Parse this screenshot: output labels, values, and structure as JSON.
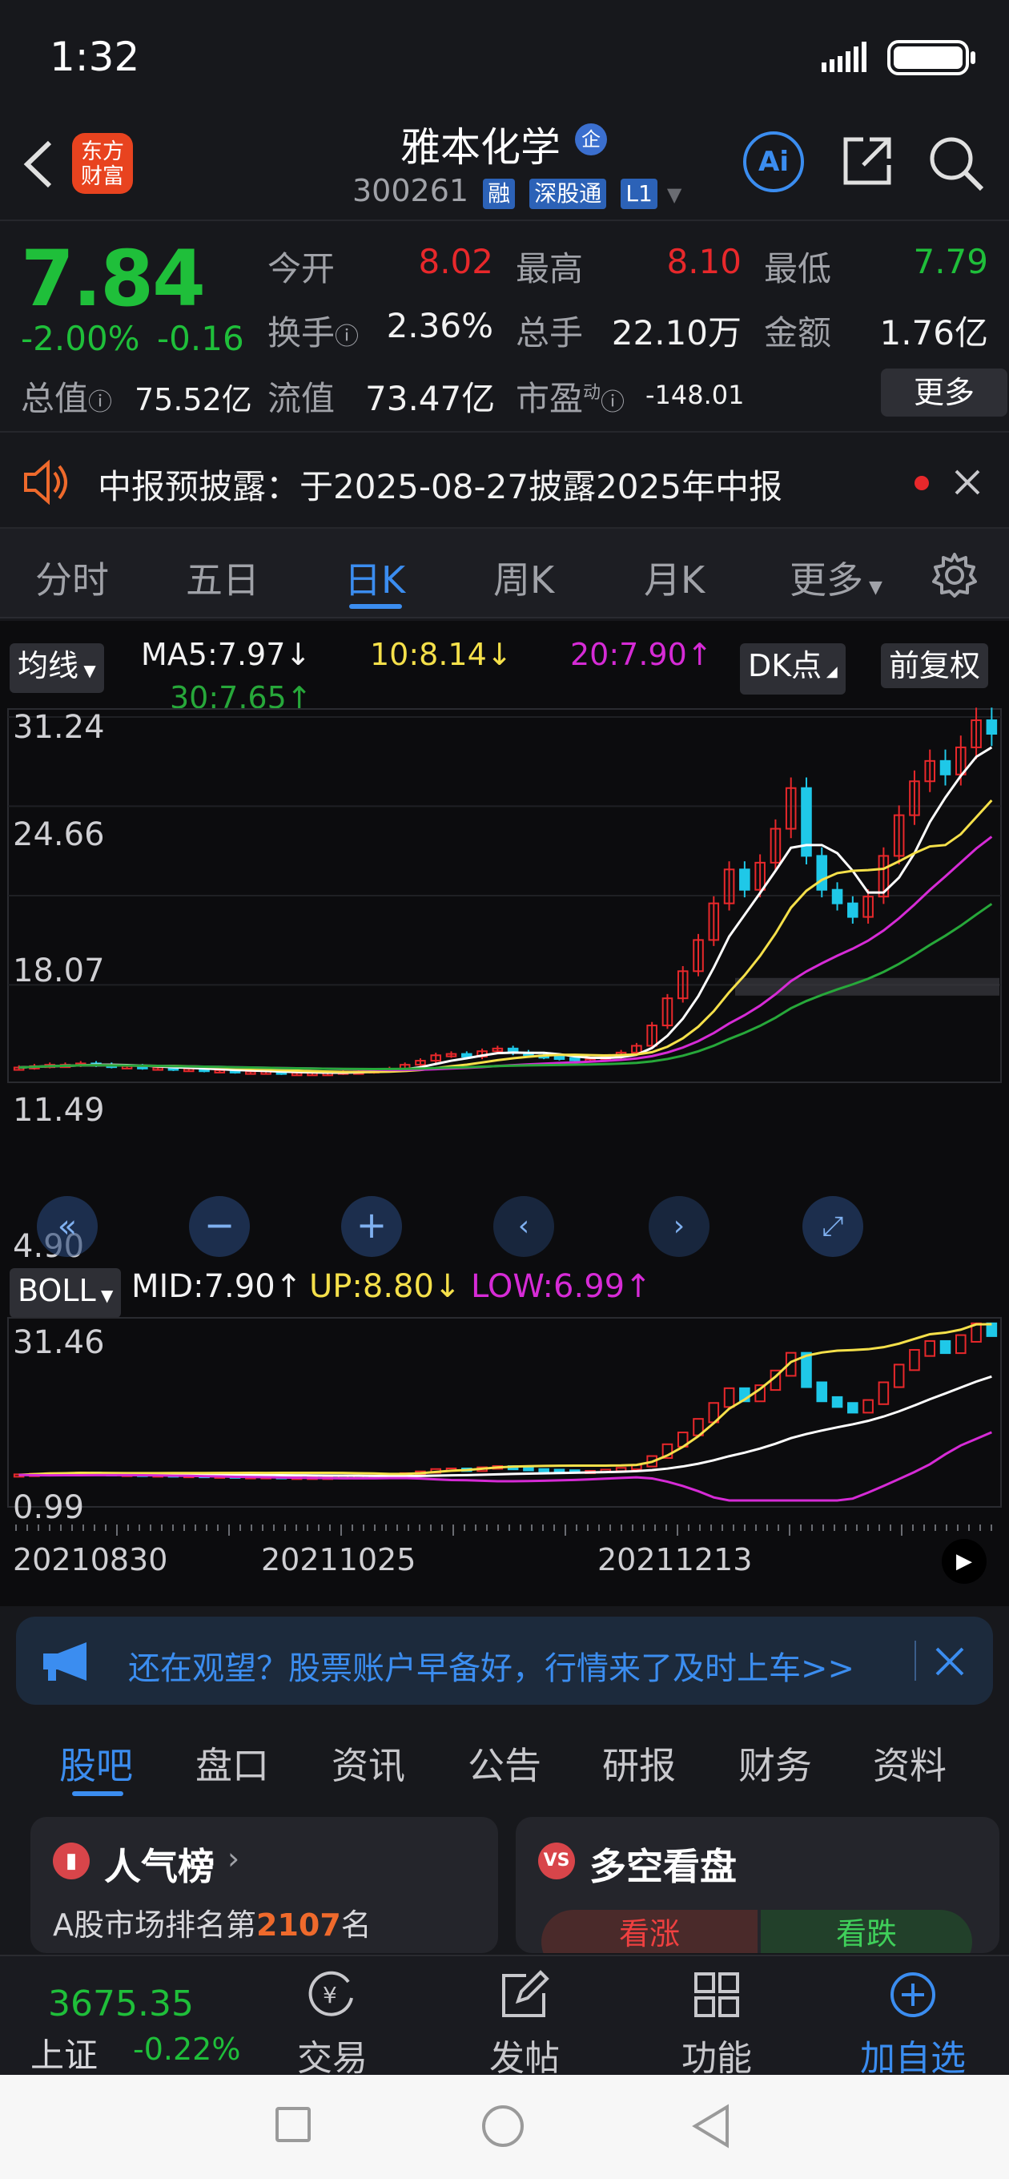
{
  "status_bar": {
    "time": "1:32"
  },
  "header": {
    "logo_text": "东方\n财富",
    "name": "雅本化学",
    "name_badge": "企",
    "code": "300261",
    "tags": [
      "融",
      "深股通",
      "L1"
    ],
    "ai_label": "Ai"
  },
  "quote": {
    "price": "7.84",
    "change_pct": "-2.00%",
    "change": "-0.16",
    "open_label": "今开",
    "open": "8.02",
    "high_label": "最高",
    "high": "8.10",
    "low_label": "最低",
    "low": "7.79",
    "turnover_label": "换手",
    "turnover": "2.36%",
    "volume_label": "总手",
    "volume": "22.10万",
    "amount_label": "金额",
    "amount": "1.76亿",
    "mktcap_label": "总值",
    "mktcap": "75.52亿",
    "float_label": "流值",
    "float": "73.47亿",
    "pe_label": "市盈",
    "pe_sup": "动",
    "pe": "-148.01",
    "more_label": "更多"
  },
  "notice": {
    "text": "中报预披露：于2025-08-27披露2025年中报"
  },
  "ktabs": [
    "分时",
    "五日",
    "日K",
    "周K",
    "月K",
    "更多"
  ],
  "ktabs_active": 2,
  "main_chart": {
    "indicator_button": "均线",
    "ma5": "MA5:7.97↓",
    "ma10": "10:8.14↓",
    "ma20": "20:7.90↑",
    "ma30": "30:7.65↑",
    "dk_button": "DK点",
    "adjust_button": "前复权",
    "y_labels": [
      "31.24",
      "24.66",
      "18.07",
      "11.49",
      "4.90"
    ]
  },
  "boll_chart": {
    "indicator_button": "BOLL",
    "mid": "MID:7.90↑",
    "up": "UP:8.80↓",
    "low": "LOW:6.99↑",
    "y_labels": [
      "31.46",
      "0.99"
    ]
  },
  "x_labels": [
    "20210830",
    "20211025",
    "20211213"
  ],
  "colors": {
    "up": "#e8282b",
    "down": "#1fc8e8",
    "ma5": "#ffffff",
    "ma10": "#f5e04a",
    "ma20": "#d62bd6",
    "ma30": "#27a83a",
    "accent": "#3b8df0"
  },
  "ad_banner": {
    "text": "还在观望？股票账户早备好，行情来了及时上车>>"
  },
  "bottom_tabs": [
    "股吧",
    "盘口",
    "资讯",
    "公告",
    "研报",
    "财务",
    "资料"
  ],
  "bottom_tabs_active": 0,
  "cards": {
    "popularity_title": "人气榜",
    "popularity_text_prefix": "A股市场排名第",
    "popularity_rank": "2107",
    "popularity_text_suffix": "名",
    "sentiment_title": "多空看盘",
    "bull_label": "看涨",
    "bear_label": "看跌"
  },
  "bottom_nav": {
    "index_value": "3675.35",
    "index_name": "上证",
    "index_change": "-0.22%",
    "trade": "交易",
    "post": "发帖",
    "functions": "功能",
    "add_watch": "加自选"
  },
  "chart_data": {
    "type": "candlestick",
    "title": "",
    "indicators": [
      "MA5",
      "MA10",
      "MA20",
      "MA30",
      "BOLL"
    ],
    "y_ticks_main": [
      31.24,
      24.66,
      18.07,
      11.49,
      4.9
    ],
    "y_ticks_boll": [
      31.46,
      0.99
    ],
    "x_ticks": [
      "20210830",
      "20211025",
      "20211213"
    ],
    "ylim": [
      4.9,
      31.24
    ],
    "close_series_approx": [
      5.4,
      5.5,
      5.6,
      5.6,
      5.7,
      5.6,
      5.5,
      5.5,
      5.4,
      5.4,
      5.3,
      5.3,
      5.2,
      5.2,
      5.1,
      5.1,
      5.1,
      5.0,
      5.0,
      5.0,
      5.0,
      5.1,
      5.1,
      5.2,
      5.3,
      5.6,
      5.9,
      6.3,
      6.4,
      6.2,
      6.6,
      6.8,
      6.5,
      6.3,
      6.2,
      6.1,
      6.0,
      6.0,
      6.2,
      6.5,
      7.0,
      8.5,
      10.5,
      12.5,
      14.8,
      17.5,
      20.0,
      18.5,
      20.5,
      23.0,
      26.0,
      21.0,
      18.5,
      17.5,
      16.5,
      18.0,
      21.0,
      24.0,
      26.5,
      28.0,
      27.0,
      29.0,
      31.0,
      30.0
    ]
  }
}
